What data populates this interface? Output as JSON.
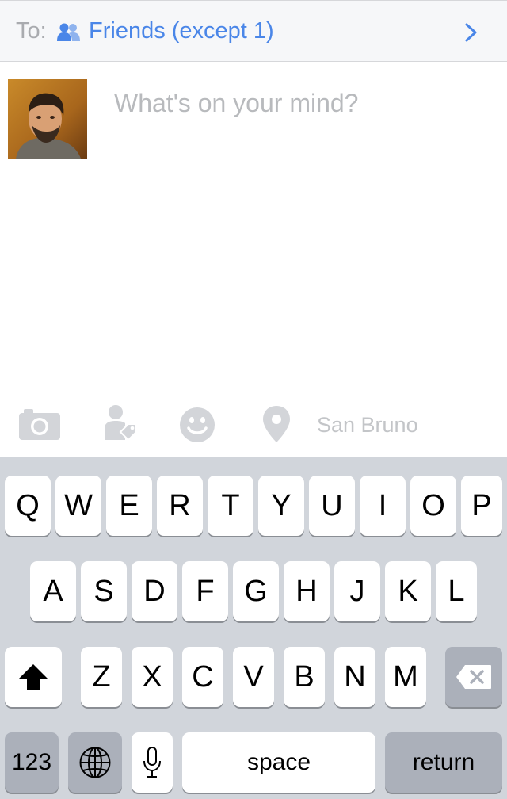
{
  "audience": {
    "to_label": "To:",
    "value": "Friends (except 1)",
    "icon": "friends-icon",
    "chevron_icon": "chevron-right-icon",
    "accent_color": "#4a86e8"
  },
  "composer": {
    "avatar": "profile-photo",
    "placeholder": "What's on your mind?"
  },
  "attachments": {
    "items": [
      "camera-icon",
      "tag-people-icon",
      "feeling-smiley-icon",
      "location-pin-icon"
    ],
    "location_label": "San Bruno"
  },
  "keyboard": {
    "row1": [
      "Q",
      "W",
      "E",
      "R",
      "T",
      "Y",
      "U",
      "I",
      "O",
      "P"
    ],
    "row2": [
      "A",
      "S",
      "D",
      "F",
      "G",
      "H",
      "J",
      "K",
      "L"
    ],
    "row3": [
      "Z",
      "X",
      "C",
      "V",
      "B",
      "N",
      "M"
    ],
    "shift_icon": "shift-arrow-icon",
    "delete_icon": "backspace-icon",
    "numbers_label": "123",
    "globe_icon": "globe-icon",
    "mic_icon": "microphone-icon",
    "space_label": "space",
    "return_label": "return"
  }
}
